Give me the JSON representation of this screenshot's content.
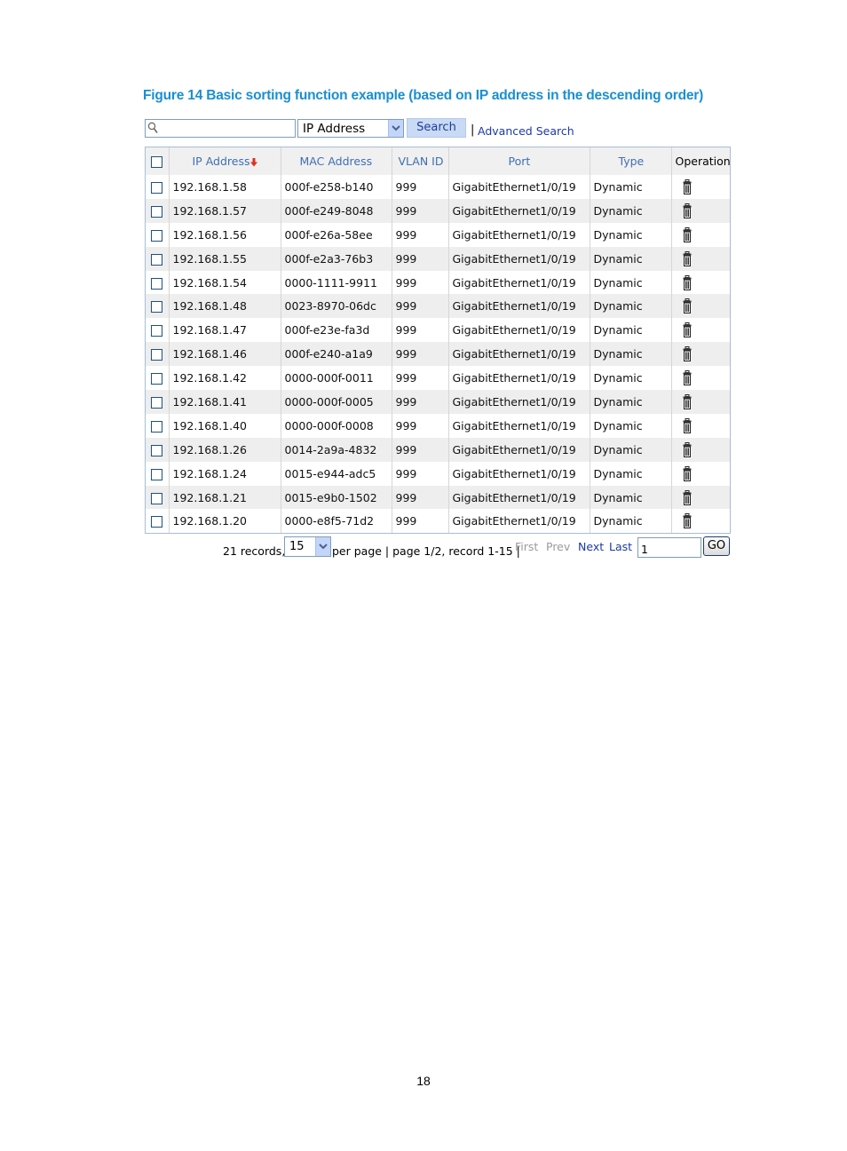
{
  "caption": "Figure 14 Basic sorting function example (based on IP address in the descending order)",
  "toolbar": {
    "search_value": "",
    "field_selected": "IP Address",
    "search_label": "Search",
    "separator": "|",
    "advanced_label": "Advanced Search"
  },
  "table": {
    "headers": [
      "IP Address",
      "MAC Address",
      "VLAN ID",
      "Port",
      "Type",
      "Operation"
    ],
    "sort_column": "IP Address",
    "sort_direction": "descending",
    "rows": [
      [
        "192.168.1.58",
        "000f-e258-b140",
        "999",
        "GigabitEthernet1/0/19",
        "Dynamic"
      ],
      [
        "192.168.1.57",
        "000f-e249-8048",
        "999",
        "GigabitEthernet1/0/19",
        "Dynamic"
      ],
      [
        "192.168.1.56",
        "000f-e26a-58ee",
        "999",
        "GigabitEthernet1/0/19",
        "Dynamic"
      ],
      [
        "192.168.1.55",
        "000f-e2a3-76b3",
        "999",
        "GigabitEthernet1/0/19",
        "Dynamic"
      ],
      [
        "192.168.1.54",
        "0000-1111-9911",
        "999",
        "GigabitEthernet1/0/19",
        "Dynamic"
      ],
      [
        "192.168.1.48",
        "0023-8970-06dc",
        "999",
        "GigabitEthernet1/0/19",
        "Dynamic"
      ],
      [
        "192.168.1.47",
        "000f-e23e-fa3d",
        "999",
        "GigabitEthernet1/0/19",
        "Dynamic"
      ],
      [
        "192.168.1.46",
        "000f-e240-a1a9",
        "999",
        "GigabitEthernet1/0/19",
        "Dynamic"
      ],
      [
        "192.168.1.42",
        "0000-000f-0011",
        "999",
        "GigabitEthernet1/0/19",
        "Dynamic"
      ],
      [
        "192.168.1.41",
        "0000-000f-0005",
        "999",
        "GigabitEthernet1/0/19",
        "Dynamic"
      ],
      [
        "192.168.1.40",
        "0000-000f-0008",
        "999",
        "GigabitEthernet1/0/19",
        "Dynamic"
      ],
      [
        "192.168.1.26",
        "0014-2a9a-4832",
        "999",
        "GigabitEthernet1/0/19",
        "Dynamic"
      ],
      [
        "192.168.1.24",
        "0015-e944-adc5",
        "999",
        "GigabitEthernet1/0/19",
        "Dynamic"
      ],
      [
        "192.168.1.21",
        "0015-e9b0-1502",
        "999",
        "GigabitEthernet1/0/19",
        "Dynamic"
      ],
      [
        "192.168.1.20",
        "0000-e8f5-71d2",
        "999",
        "GigabitEthernet1/0/19",
        "Dynamic"
      ]
    ]
  },
  "pagination": {
    "records_text": "21 records,",
    "per_page_selected": "15",
    "page_text": "per page | page 1/2, record 1-15 |",
    "first_label": "First",
    "prev_label": "Prev",
    "next_label": "Next",
    "last_label": "Last",
    "page_input": "1",
    "go_label": "GO"
  },
  "page_number": "18",
  "colors": {
    "caption": "#1a8fd1",
    "header_text": "#3f6fb3",
    "link": "#1c3aa8",
    "sort_arrow": "#e03020",
    "disabled": "#9a9a9a"
  },
  "icons": {
    "search": "magnifier-icon",
    "delete": "trash-icon",
    "sort": "sort-desc-arrow-icon",
    "dropdown": "chevron-down-icon"
  }
}
